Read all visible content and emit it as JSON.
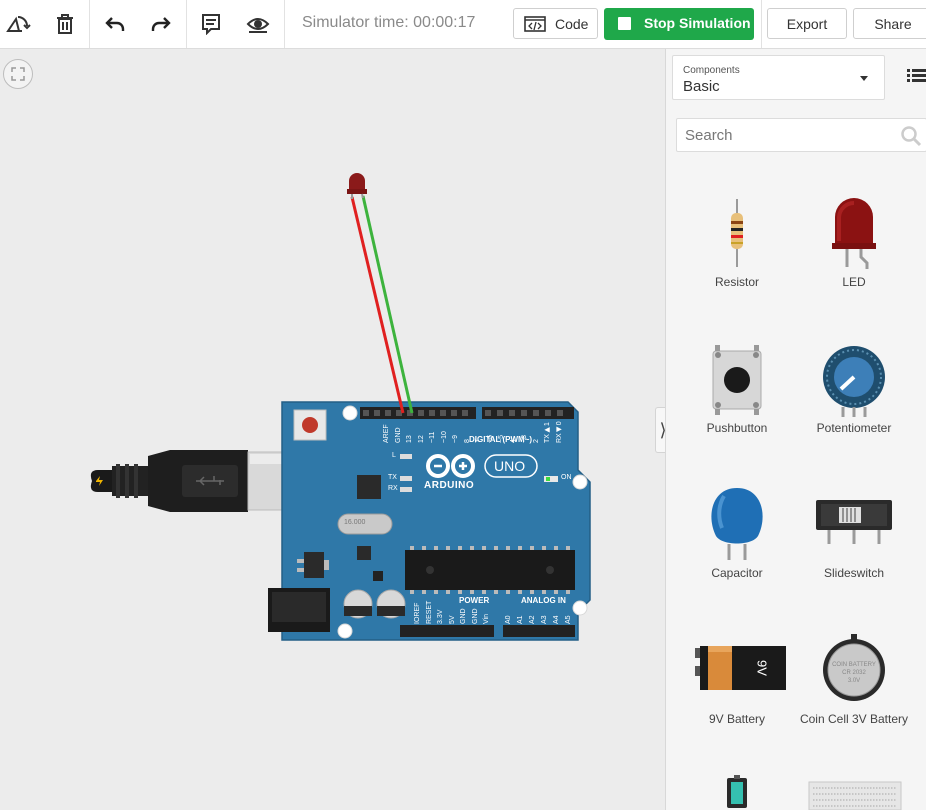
{
  "toolbar": {
    "icons": [
      "rotate-icon",
      "trash-icon",
      "undo-icon",
      "redo-icon",
      "notes-icon",
      "visibility-icon"
    ],
    "simulator_time": "Simulator time: 00:00:17",
    "code_label": "Code",
    "stop_label": "Stop Simulation",
    "export_label": "Export",
    "share_label": "Share"
  },
  "board": {
    "pin_labels": [
      "AREF",
      "GND",
      "13",
      "12",
      "~11",
      "~10",
      "~9",
      "8",
      "7",
      "~6",
      "~5",
      "4",
      "~3",
      "2",
      "TX▶1",
      "RX◀0"
    ],
    "digital_label": "DIGITAL (PWM~)",
    "brand": "ARDUINO",
    "model": "UNO",
    "on_label": "ON",
    "l_label": "L",
    "tx_label": "TX",
    "rx_label": "RX",
    "power_label": "POWER",
    "analog_label": "ANALOG IN",
    "power_pins": [
      "IOREF",
      "RESET",
      "3.3V",
      "5V",
      "GND",
      "GND",
      "Vin"
    ],
    "analog_pins": [
      "A0",
      "A1",
      "A2",
      "A3",
      "A4",
      "A5"
    ],
    "crystal": "16.000"
  },
  "wires": {
    "red": "#e02020",
    "green": "#3db33d"
  },
  "panel": {
    "select_caption": "Components",
    "select_value": "Basic",
    "search_placeholder": "Search",
    "components": [
      {
        "name": "Resistor",
        "icon": "resistor-icon"
      },
      {
        "name": "LED",
        "icon": "led-icon"
      },
      {
        "name": "Pushbutton",
        "icon": "pushbutton-icon"
      },
      {
        "name": "Potentiometer",
        "icon": "potentiometer-icon"
      },
      {
        "name": "Capacitor",
        "icon": "capacitor-icon"
      },
      {
        "name": "Slideswitch",
        "icon": "slideswitch-icon"
      },
      {
        "name": "9V Battery",
        "icon": "battery-9v-icon"
      },
      {
        "name": "Coin Cell 3V Battery",
        "icon": "coin-cell-icon"
      }
    ],
    "battery_text": "9V",
    "coin_text": [
      "COIN BATTERY",
      "CR 2032",
      "3.0V"
    ]
  },
  "colors": {
    "accent_green": "#1fa84a",
    "board_blue": "#2f78a8",
    "canvas_bg": "#ececec"
  }
}
